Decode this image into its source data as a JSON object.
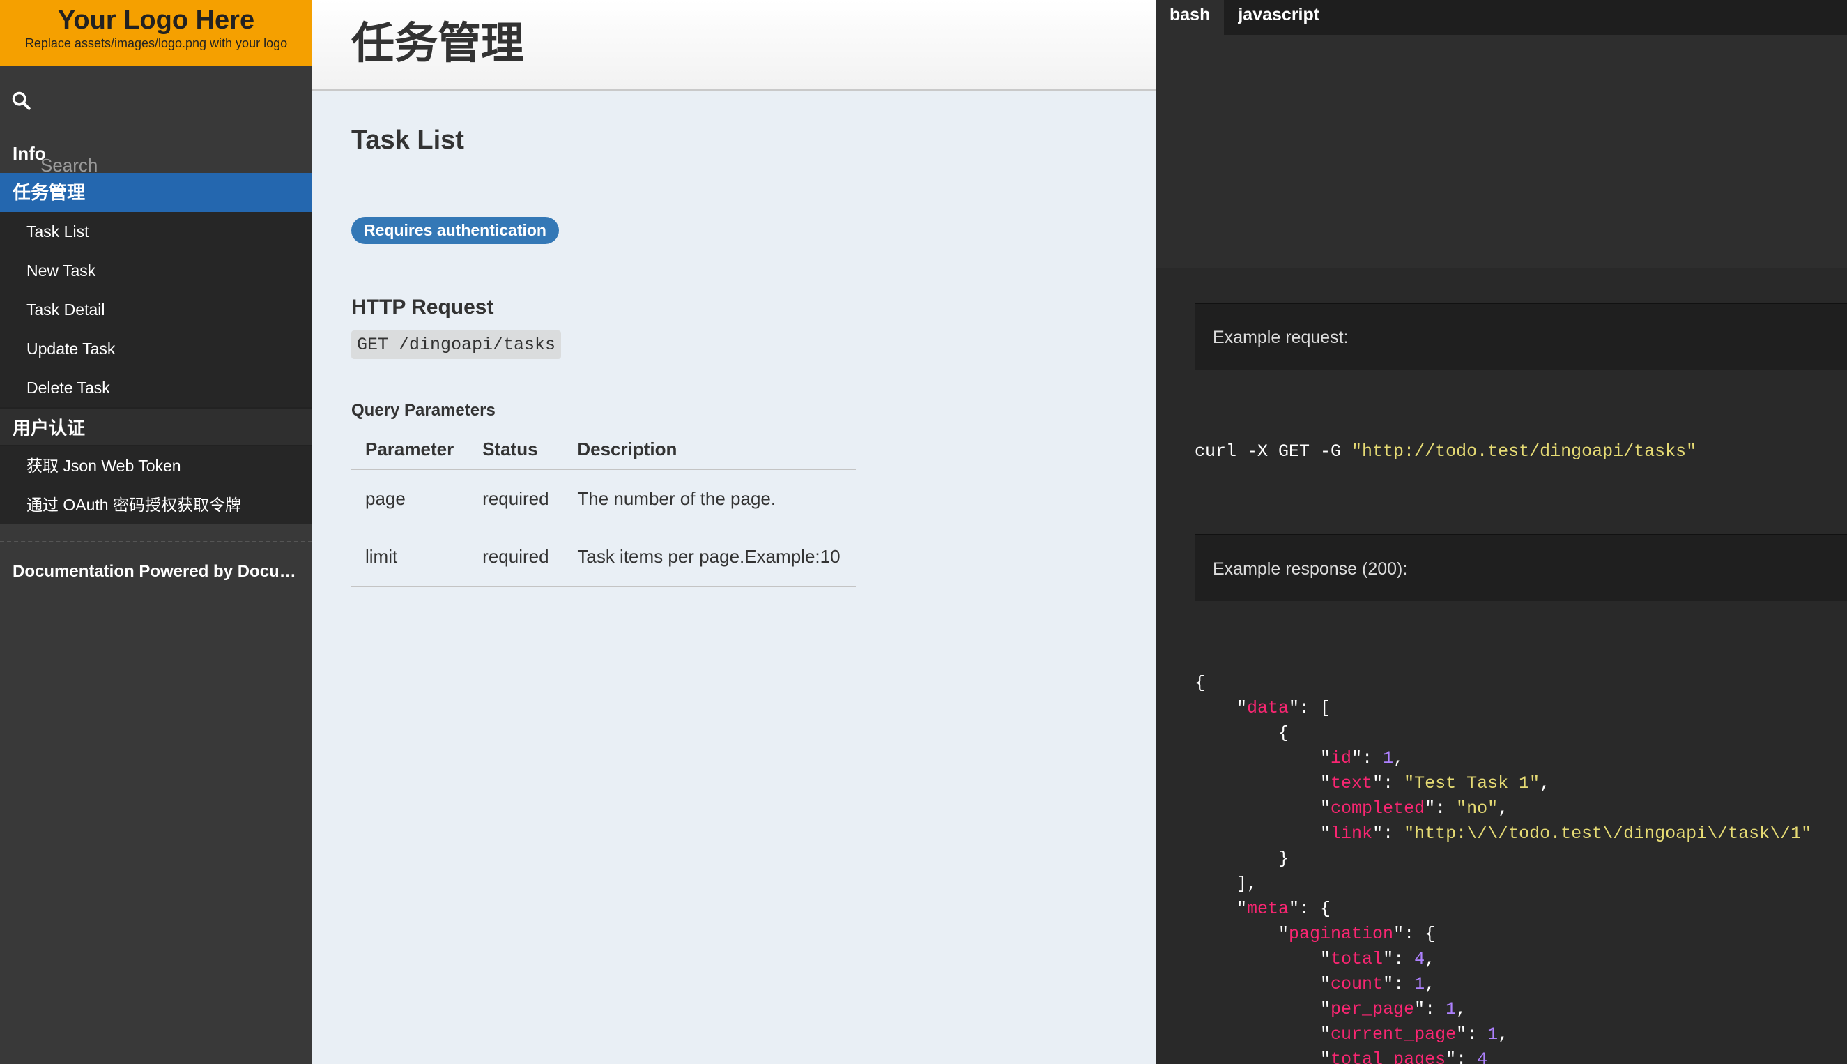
{
  "logo": {
    "title": "Your Logo Here",
    "subtitle": "Replace assets/images/logo.png with your logo"
  },
  "search": {
    "placeholder": "Search"
  },
  "nav": {
    "info": "Info",
    "task_group": "任务管理",
    "task_items": [
      "Task List",
      "New Task",
      "Task Detail",
      "Update Task",
      "Delete Task"
    ],
    "auth_group": "用户认证",
    "auth_items": [
      "获取 Json Web Token",
      "通过 OAuth 密码授权获取令牌"
    ],
    "powered": "Documentation Powered by Documentarian"
  },
  "page": {
    "title": "任务管理",
    "section_title": "Task List",
    "badge": "Requires authentication",
    "http_request_heading": "HTTP Request",
    "endpoint": "GET /dingoapi/tasks",
    "query_heading": "Query Parameters",
    "table": {
      "headers": [
        "Parameter",
        "Status",
        "Description"
      ],
      "rows": [
        [
          "page",
          "required",
          "The number of the page."
        ],
        [
          "limit",
          "required",
          "Task items per page.Example:10"
        ]
      ]
    }
  },
  "code_panel": {
    "tabs": [
      "bash",
      "javascript"
    ],
    "example_request_label": "Example request:",
    "curl_cmd": "curl -X GET -G ",
    "curl_url": "\"http://todo.test/dingoapi/tasks\"",
    "example_response_label": "Example response (200):",
    "response": {
      "id": "1",
      "text": "\"Test Task 1\"",
      "completed": "\"no\"",
      "link": "\"http:\\/\\/todo.test\\/dingoapi\\/task\\/1\"",
      "total": "4",
      "count": "1",
      "per_page": "1",
      "current_page": "1",
      "total_pages": "4"
    }
  },
  "colors": {
    "accent": "#2467af",
    "logo_bg": "#f5a000",
    "badge": "#3478b6"
  }
}
